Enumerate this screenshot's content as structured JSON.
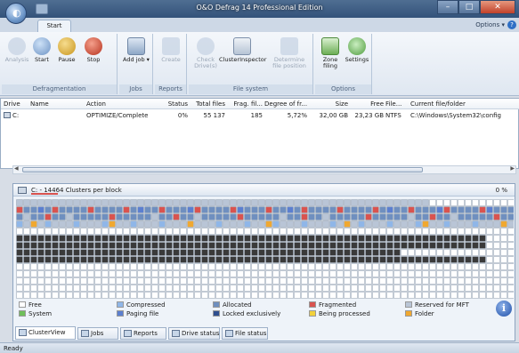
{
  "window": {
    "title": "O&O Defrag 14 Professional Edition",
    "buttons": {
      "minimize": "–",
      "maximize": "□",
      "close": "✕"
    }
  },
  "ribbon": {
    "tab_start": "Start",
    "options": "Options ▾",
    "help": "?",
    "groups": {
      "defragmentation": {
        "label": "Defragmentation",
        "analysis": "Analysis",
        "start": "Start",
        "pause": "Pause",
        "stop": "Stop"
      },
      "jobs": {
        "label": "Jobs",
        "add_job": "Add job ▾"
      },
      "reports": {
        "label": "Reports",
        "create": "Create"
      },
      "file_system": {
        "label": "File system",
        "check_drives": "Check Drive(s)",
        "cluster_inspector": "ClusterInspector",
        "determine_file_position": "Determine file position"
      },
      "options": {
        "label": "Options",
        "zone_filing": "Zone filing",
        "settings": "Settings"
      }
    }
  },
  "drives_table": {
    "columns": [
      "Drive",
      "Name",
      "Action",
      "Status",
      "Total files",
      "Frag. fil...",
      "Degree of fr...",
      "Size",
      "Free",
      "File...",
      "Current file/folder"
    ],
    "rows": [
      {
        "drive": "C:",
        "name": "",
        "action": "OPTIMIZE/Complete",
        "status": "0%",
        "total_files": "55 137",
        "frag_files": "185",
        "degree_frag": "5,72%",
        "size": "32,00 GB",
        "free": "23,23 GB",
        "fs": "NTFS",
        "current": "C:\\Windows\\System32\\config"
      }
    ]
  },
  "cluster_view": {
    "header": "C: - 14464 Clusters per block",
    "percent": "0 %",
    "progress": 0.23,
    "colors": {
      "free": "#ffffff",
      "system": "#6fbf5a",
      "compressed": "#8fb6e8",
      "paging": "#5b7fd0",
      "allocated": "#6f8fbf",
      "locked": "#2f4f8f",
      "fragmented": "#d9534f",
      "processing": "#f2d13b",
      "mft": "#b9c5d6",
      "folder": "#f0a830",
      "dark": "#3a3a3a"
    },
    "legend": {
      "free": "Free",
      "system": "System",
      "compressed": "Compressed",
      "paging": "Paging file",
      "allocated": "Allocated",
      "locked": "Locked exclusively",
      "fragmented": "Fragmented",
      "processing": "Being processed",
      "mft": "Reserved for MFT",
      "folder": "Folder"
    },
    "tabs": [
      "ClusterView",
      "Jobs",
      "Reports",
      "Drive status",
      "File status"
    ]
  },
  "statusbar": {
    "text": "Ready"
  }
}
